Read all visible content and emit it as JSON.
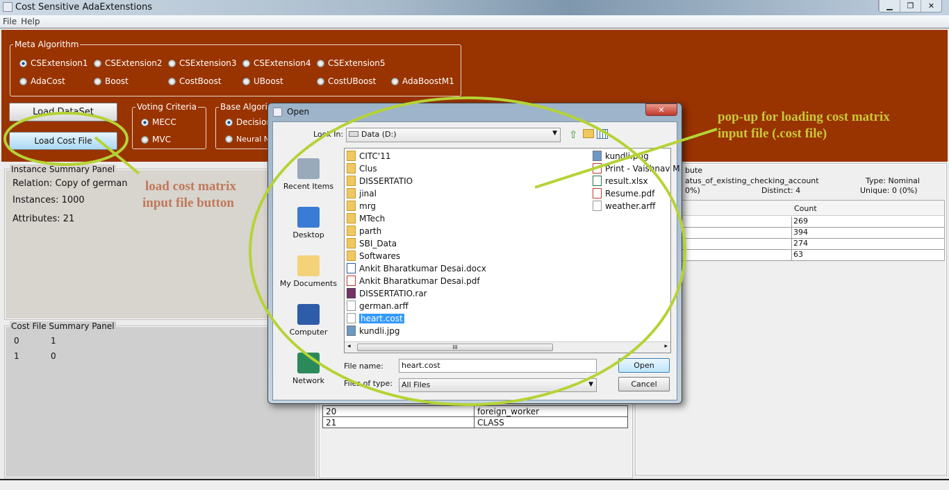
{
  "window": {
    "title": "Cost Sensitive AdaExtenstions",
    "controls": [
      "minimize",
      "restore",
      "close"
    ]
  },
  "menu": [
    "File",
    "Help"
  ],
  "meta_algorithm": {
    "label": "Meta Algorithm",
    "options": [
      "CSExtension1",
      "CSExtension2",
      "CSExtension3",
      "CSExtension4",
      "CSExtension5",
      "AdaCost",
      "Boost",
      "CostBoost",
      "UBoost",
      "CostUBoost",
      "AdaBoostM1"
    ],
    "selected": "CSExtension1"
  },
  "buttons": {
    "load_dataset": "Load DataSet",
    "load_cost_file": "Load Cost File"
  },
  "voting": {
    "label": "Voting Criteria",
    "options": [
      "MECC",
      "MVC"
    ],
    "selected": "MECC"
  },
  "base": {
    "label": "Base Algori",
    "options": [
      "Decision",
      "Neural Ne"
    ],
    "selected": "Decision"
  },
  "instance_panel": {
    "title": "Instance Summary Panel",
    "relation": "Relation: Copy of german",
    "instances": "Instances: 1000",
    "attributes": "Attributes: 21"
  },
  "cost_panel": {
    "title": "Cost File Summary Panel",
    "matrix": [
      [
        "0",
        "1"
      ],
      [
        "1",
        "0"
      ]
    ]
  },
  "attr_table": {
    "rows": [
      [
        "20",
        "foreign_worker"
      ],
      [
        "21",
        "CLASS"
      ]
    ]
  },
  "selected_attribute": {
    "title": "bute",
    "name": "atus_of_existing_checking_account",
    "missing": "0%)",
    "distinct": "Distinct: 4",
    "type": "Type: Nominal",
    "unique": "Unique: 0 (0%)",
    "count_header": "Count",
    "counts": [
      "269",
      "394",
      "274",
      "63"
    ]
  },
  "dialog": {
    "title": "Open",
    "look_in_label": "Look In:",
    "look_in": "Data (D:)",
    "places": [
      "Recent Items",
      "Desktop",
      "My Documents",
      "Computer",
      "Network"
    ],
    "files_col1": [
      {
        "name": "CITC'11",
        "icon": "folder"
      },
      {
        "name": "Clus",
        "icon": "folder"
      },
      {
        "name": "DISSERTATIO",
        "icon": "folder"
      },
      {
        "name": "jinal",
        "icon": "folder"
      },
      {
        "name": "mrg",
        "icon": "folder"
      },
      {
        "name": "MTech",
        "icon": "folder"
      },
      {
        "name": "parth",
        "icon": "folder"
      },
      {
        "name": "SBI_Data",
        "icon": "folder"
      },
      {
        "name": "Softwares",
        "icon": "folder"
      },
      {
        "name": "Ankit Bharatkumar Desai.docx",
        "icon": "word"
      },
      {
        "name": "Ankit Bharatkumar Desai.pdf",
        "icon": "pdf"
      },
      {
        "name": "DISSERTATIO.rar",
        "icon": "rar"
      },
      {
        "name": "german.arff",
        "icon": "file"
      },
      {
        "name": "heart.cost",
        "icon": "file"
      },
      {
        "name": "kundli.jpg",
        "icon": "image"
      }
    ],
    "files_col2": [
      {
        "name": "kundli.png",
        "icon": "image"
      },
      {
        "name": "Print - Vaishnav M",
        "icon": "pdf"
      },
      {
        "name": "result.xlsx",
        "icon": "excel"
      },
      {
        "name": "Resume.pdf",
        "icon": "pdf"
      },
      {
        "name": "weather.arff",
        "icon": "file"
      }
    ],
    "selected_file": "heart.cost",
    "file_name_label": "File name:",
    "file_name": "heart.cost",
    "file_type_label": "Files of type:",
    "file_type": "All Files",
    "open": "Open",
    "cancel": "Cancel"
  },
  "annotations": {
    "button_note": [
      "load cost matrix",
      "input file button"
    ],
    "popup_note": [
      "pop-up for loading cost matrix",
      "input file (.cost file)"
    ]
  },
  "colors": {
    "brown": "#993300",
    "highlight": "#b5d336",
    "note_button": "#c0785a",
    "note_popup": "#c9c83a",
    "selection": "#3399ff"
  }
}
